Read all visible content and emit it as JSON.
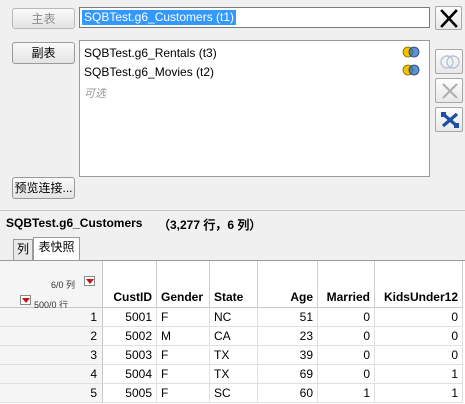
{
  "join": {
    "primary_button": "主表",
    "primary_value": "SQBTest.g6_Customers (t1)",
    "secondary_button": "副表",
    "secondary_items": [
      {
        "label": "SQBTest.g6_Rentals (t3)",
        "icon": "venn-join-icon"
      },
      {
        "label": "SQBTest.g6_Movies (t2)",
        "icon": "venn-join-icon"
      }
    ],
    "optional_label": "可选",
    "preview_button": "预览连接..."
  },
  "colors": {
    "selection": "#3399ff",
    "close_icon": "#000000",
    "join_icon_a": "#f2c200",
    "join_icon_b": "#2b6cc4",
    "cross_icon": "#1f4fa3",
    "red_menu": "#cc1111"
  },
  "table": {
    "title": "SQBTest.g6_Customers",
    "meta": "（3,277 行，6 列）",
    "tabs": [
      "列",
      "表快照"
    ],
    "active_tab": 1,
    "col_count": "6/0 列",
    "row_count": "500/0 行",
    "columns": [
      "CustID",
      "Gender",
      "State",
      "Age",
      "Married",
      "KidsUnder12"
    ],
    "rows": [
      {
        "n": "1",
        "CustID": "5001",
        "Gender": "F",
        "State": "NC",
        "Age": "51",
        "Married": "0",
        "KidsUnder12": "0"
      },
      {
        "n": "2",
        "CustID": "5002",
        "Gender": "M",
        "State": "CA",
        "Age": "23",
        "Married": "0",
        "KidsUnder12": "0"
      },
      {
        "n": "3",
        "CustID": "5003",
        "Gender": "F",
        "State": "TX",
        "Age": "39",
        "Married": "0",
        "KidsUnder12": "0"
      },
      {
        "n": "4",
        "CustID": "5004",
        "Gender": "F",
        "State": "TX",
        "Age": "69",
        "Married": "0",
        "KidsUnder12": "1"
      },
      {
        "n": "5",
        "CustID": "5005",
        "Gender": "F",
        "State": "SC",
        "Age": "60",
        "Married": "1",
        "KidsUnder12": "1"
      }
    ]
  }
}
